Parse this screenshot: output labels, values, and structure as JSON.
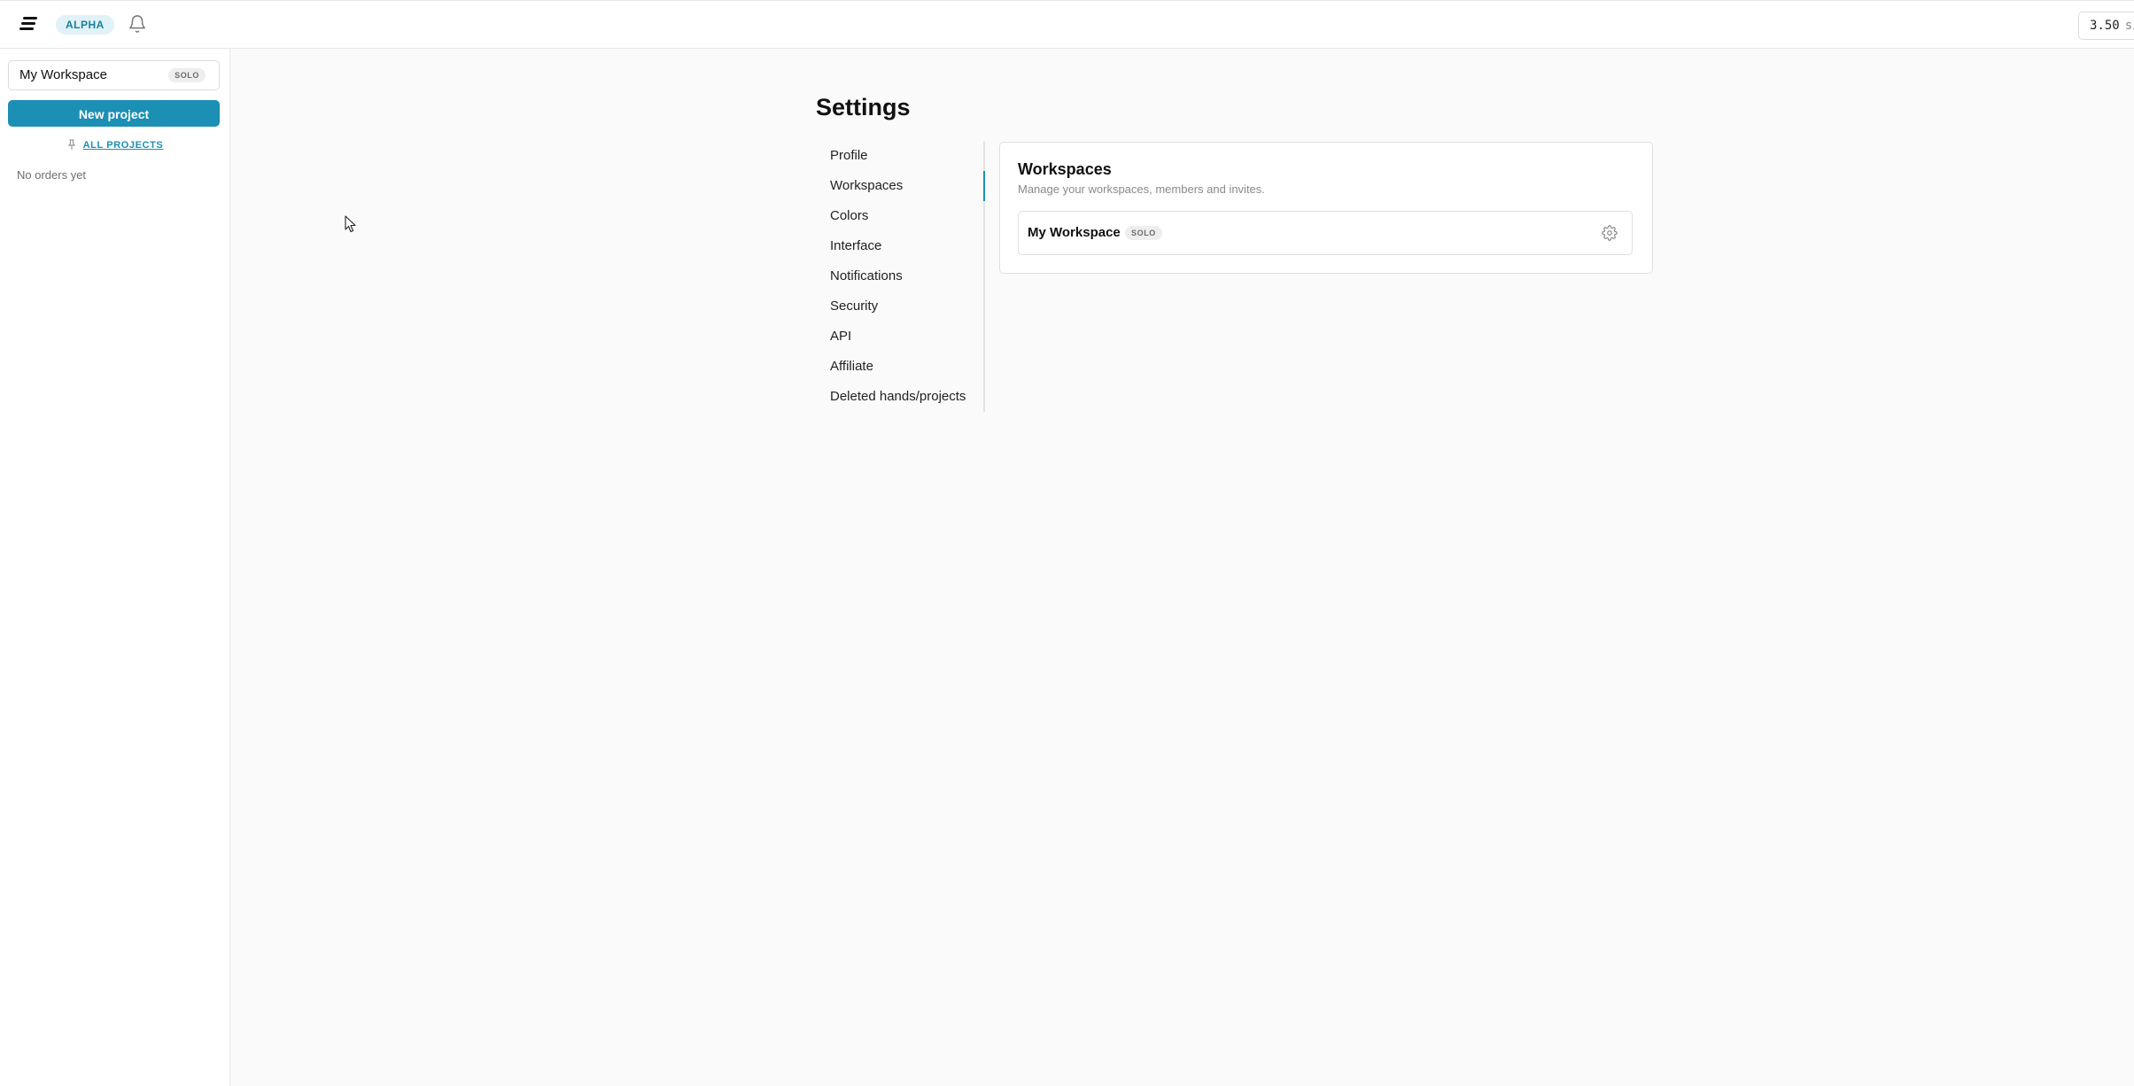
{
  "topbar": {
    "badge": "ALPHA",
    "credits_value": "3.50",
    "credits_unit": "sim"
  },
  "sidebar": {
    "workspace_name": "My Workspace",
    "workspace_badge": "SOLO",
    "new_project_label": "New project",
    "all_projects_label": "ALL PROJECTS",
    "empty_text": "No orders yet"
  },
  "settings": {
    "title": "Settings",
    "nav": [
      {
        "label": "Profile"
      },
      {
        "label": "Workspaces"
      },
      {
        "label": "Colors"
      },
      {
        "label": "Interface"
      },
      {
        "label": "Notifications"
      },
      {
        "label": "Security"
      },
      {
        "label": "API"
      },
      {
        "label": "Affiliate"
      },
      {
        "label": "Deleted hands/projects"
      }
    ],
    "active_nav": "Workspaces"
  },
  "workspaces_panel": {
    "title": "Workspaces",
    "description": "Manage your workspaces, members and invites.",
    "items": [
      {
        "name": "My Workspace",
        "badge": "SOLO"
      }
    ]
  },
  "colors": {
    "accent": "#1c8fb4",
    "alpha_badge_bg": "#e0f2f7"
  }
}
